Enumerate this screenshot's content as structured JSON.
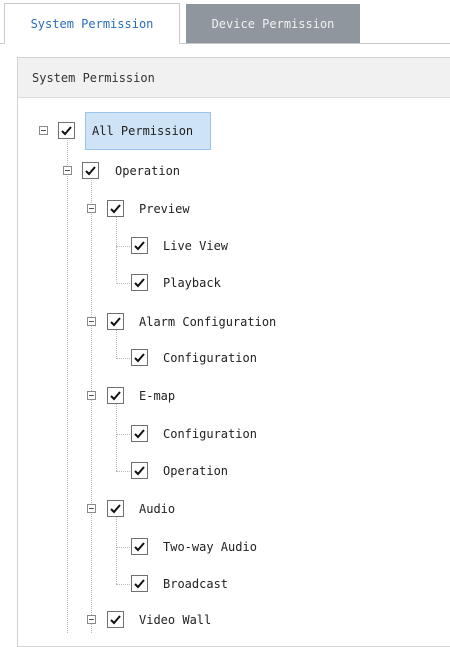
{
  "tabs": [
    {
      "label": "System Permission",
      "active": true
    },
    {
      "label": "Device Permission",
      "active": false
    }
  ],
  "panel": {
    "header": "System Permission"
  },
  "tree": {
    "all": "All Permission",
    "operation": "Operation",
    "preview": "Preview",
    "live_view": "Live View",
    "playback": "Playback",
    "alarm_configuration": "Alarm Configuration",
    "alarm_config_child": "Configuration",
    "emap": "E-map",
    "emap_configuration": "Configuration",
    "emap_operation": "Operation",
    "audio": "Audio",
    "two_way_audio": "Two-way Audio",
    "broadcast": "Broadcast",
    "video_wall": "Video Wall"
  },
  "colors": {
    "accent": "#2a6ebb",
    "inactive_tab": "#8f969d",
    "selection": "#cfe3f7"
  }
}
